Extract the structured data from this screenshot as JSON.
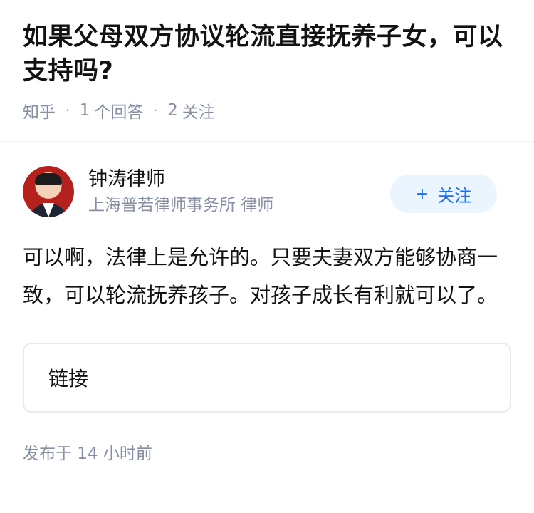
{
  "question": {
    "title": "如果父母双方协议轮流直接抚养子女，可以支持吗?",
    "source": "知乎",
    "answers_count": "1",
    "answers_label": "个回答",
    "followers_count": "2",
    "followers_label": "关注"
  },
  "answer": {
    "author_name": "钟涛律师",
    "author_desc": "上海普若律师事务所 律师",
    "follow_button": {
      "icon": "+",
      "label": "关注"
    },
    "content": "可以啊，法律上是允许的。只要夫妻双方能够协商一致，可以轮流抚养孩子。对孩子成长有利就可以了。",
    "link_label": "链接",
    "published": "发布于  14 小时前"
  },
  "colors": {
    "accent": "#1772f6",
    "follow_bg": "#ebf5ff",
    "meta_gray": "#8590a6"
  }
}
